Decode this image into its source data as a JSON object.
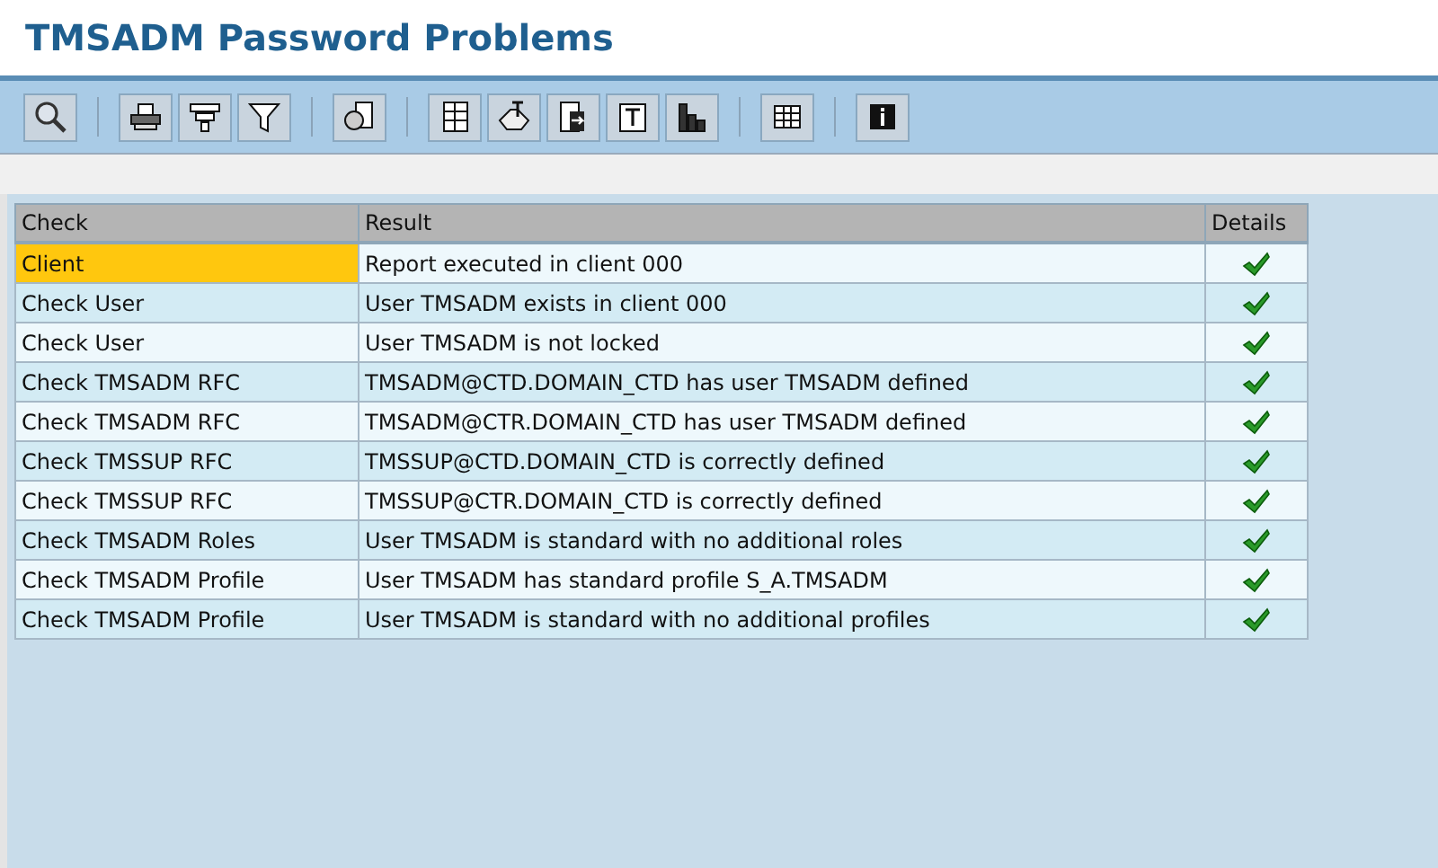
{
  "window": {
    "title": "TMSADM Password Problems"
  },
  "toolbar": {
    "groups": [
      [
        {
          "kind": "zoom"
        }
      ],
      [
        {
          "kind": "print"
        },
        {
          "kind": "subtotal"
        },
        {
          "kind": "filter"
        }
      ],
      [
        {
          "kind": "document"
        }
      ],
      [
        {
          "kind": "spreadsheet"
        },
        {
          "kind": "sort"
        },
        {
          "kind": "export"
        },
        {
          "kind": "text"
        },
        {
          "kind": "chart"
        }
      ],
      [
        {
          "kind": "grid"
        }
      ],
      [
        {
          "kind": "info"
        }
      ]
    ]
  },
  "table": {
    "columns": [
      "Check",
      "Result",
      "Details"
    ],
    "rows": [
      {
        "check": "Client",
        "result": "Report executed in client 000",
        "passed": true,
        "selected": true
      },
      {
        "check": "Check User",
        "result": "User TMSADM exists in client 000",
        "passed": true,
        "selected": false
      },
      {
        "check": "Check User",
        "result": "User TMSADM is not locked",
        "passed": true,
        "selected": false
      },
      {
        "check": "Check TMSADM RFC",
        "result": "TMSADM@CTD.DOMAIN_CTD has user TMSADM defined",
        "passed": true,
        "selected": false
      },
      {
        "check": "Check TMSADM RFC",
        "result": "TMSADM@CTR.DOMAIN_CTD has user TMSADM defined",
        "passed": true,
        "selected": false
      },
      {
        "check": "Check TMSSUP RFC",
        "result": "TMSSUP@CTD.DOMAIN_CTD is correctly defined",
        "passed": true,
        "selected": false
      },
      {
        "check": "Check TMSSUP RFC",
        "result": "TMSSUP@CTR.DOMAIN_CTD is correctly defined",
        "passed": true,
        "selected": false
      },
      {
        "check": "Check TMSADM Roles",
        "result": "User TMSADM is standard with no additional roles",
        "passed": true,
        "selected": false
      },
      {
        "check": "Check TMSADM Profile",
        "result": "User TMSADM has standard profile S_A.TMSADM",
        "passed": true,
        "selected": false
      },
      {
        "check": "Check TMSADM Profile",
        "result": "User TMSADM is standard with no additional profiles",
        "passed": true,
        "selected": false
      }
    ]
  }
}
